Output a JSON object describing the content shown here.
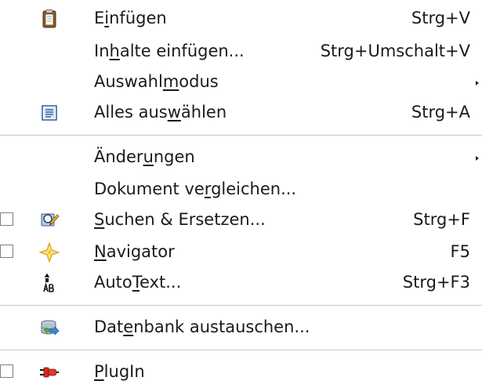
{
  "menu": {
    "items": [
      {
        "id": "einfuegen",
        "pre": "E",
        "ul": "i",
        "post": "nfügen",
        "shortcut": "Strg+V",
        "icon": "clipboard-icon",
        "checkbox": false,
        "submenu": false
      },
      {
        "id": "inhalte-einfuegen",
        "pre": "In",
        "ul": "h",
        "post": "alte einfügen...",
        "shortcut": "Strg+Umschalt+V",
        "icon": "",
        "checkbox": false,
        "submenu": false
      },
      {
        "id": "auswahlmodus",
        "pre": "Auswahl",
        "ul": "m",
        "post": "odus",
        "shortcut": "",
        "icon": "",
        "checkbox": false,
        "submenu": true
      },
      {
        "id": "alles-auswaehlen",
        "pre": "Alles aus",
        "ul": "w",
        "post": "ählen",
        "shortcut": "Strg+A",
        "icon": "select-all-icon",
        "checkbox": false,
        "submenu": false
      },
      {
        "id": "aenderungen",
        "pre": "Änder",
        "ul": "u",
        "post": "ngen",
        "shortcut": "",
        "icon": "",
        "checkbox": false,
        "submenu": true
      },
      {
        "id": "dokument-vergleichen",
        "pre": "Dokument ve",
        "ul": "r",
        "post": "gleichen...",
        "shortcut": "",
        "icon": "",
        "checkbox": false,
        "submenu": false
      },
      {
        "id": "suchen-ersetzen",
        "pre": "",
        "ul": "S",
        "post": "uchen & Ersetzen...",
        "shortcut": "Strg+F",
        "icon": "find-replace-icon",
        "checkbox": true,
        "submenu": false
      },
      {
        "id": "navigator",
        "pre": "",
        "ul": "N",
        "post": "avigator",
        "shortcut": "F5",
        "icon": "navigator-icon",
        "checkbox": true,
        "submenu": false
      },
      {
        "id": "autotext",
        "pre": "Auto",
        "ul": "T",
        "post": "ext...",
        "shortcut": "Strg+F3",
        "icon": "autotext-icon",
        "checkbox": false,
        "submenu": false
      },
      {
        "id": "datenbank-austauschen",
        "pre": "Dat",
        "ul": "e",
        "post": "nbank austauschen...",
        "shortcut": "",
        "icon": "database-exchange-icon",
        "checkbox": false,
        "submenu": false
      },
      {
        "id": "plugin",
        "pre": "",
        "ul": "P",
        "post": "lugIn",
        "shortcut": "",
        "icon": "plugin-icon",
        "checkbox": true,
        "submenu": false
      }
    ]
  }
}
